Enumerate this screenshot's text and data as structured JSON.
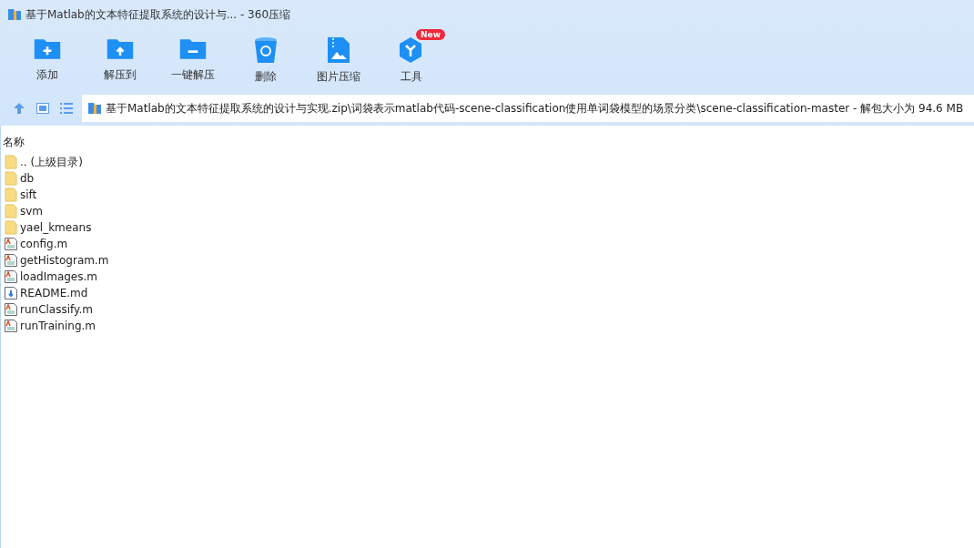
{
  "window": {
    "title": "基于Matlab的文本特征提取系统的设计与... - 360压缩"
  },
  "toolbar": [
    {
      "kind": "add",
      "label": "添加"
    },
    {
      "kind": "extract",
      "label": "解压到"
    },
    {
      "kind": "oneclick",
      "label": "一键解压"
    },
    {
      "kind": "delete",
      "label": "删除"
    },
    {
      "kind": "image",
      "label": "图片压缩"
    },
    {
      "kind": "tools",
      "label": "工具",
      "badge": "New"
    }
  ],
  "address": {
    "path": "基于Matlab的文本特征提取系统的设计与实现.zip\\词袋表示matlab代码-scene-classification使用单词袋模型的场景分类\\scene-classification-master - 解包大小为 94.6 MB"
  },
  "file_list": {
    "columns": [
      "名称"
    ],
    "rows": [
      {
        "kind": "folder",
        "name": ".. (上级目录)"
      },
      {
        "kind": "folder",
        "name": "db"
      },
      {
        "kind": "folder",
        "name": "sift"
      },
      {
        "kind": "folder",
        "name": "svm"
      },
      {
        "kind": "folder",
        "name": "yael_kmeans"
      },
      {
        "kind": "matlab",
        "name": "config.m"
      },
      {
        "kind": "matlab",
        "name": "getHistogram.m"
      },
      {
        "kind": "matlab",
        "name": "loadImages.m"
      },
      {
        "kind": "doc",
        "name": "README.md"
      },
      {
        "kind": "matlab",
        "name": "runClassify.m"
      },
      {
        "kind": "matlab",
        "name": "runTraining.m"
      }
    ]
  }
}
